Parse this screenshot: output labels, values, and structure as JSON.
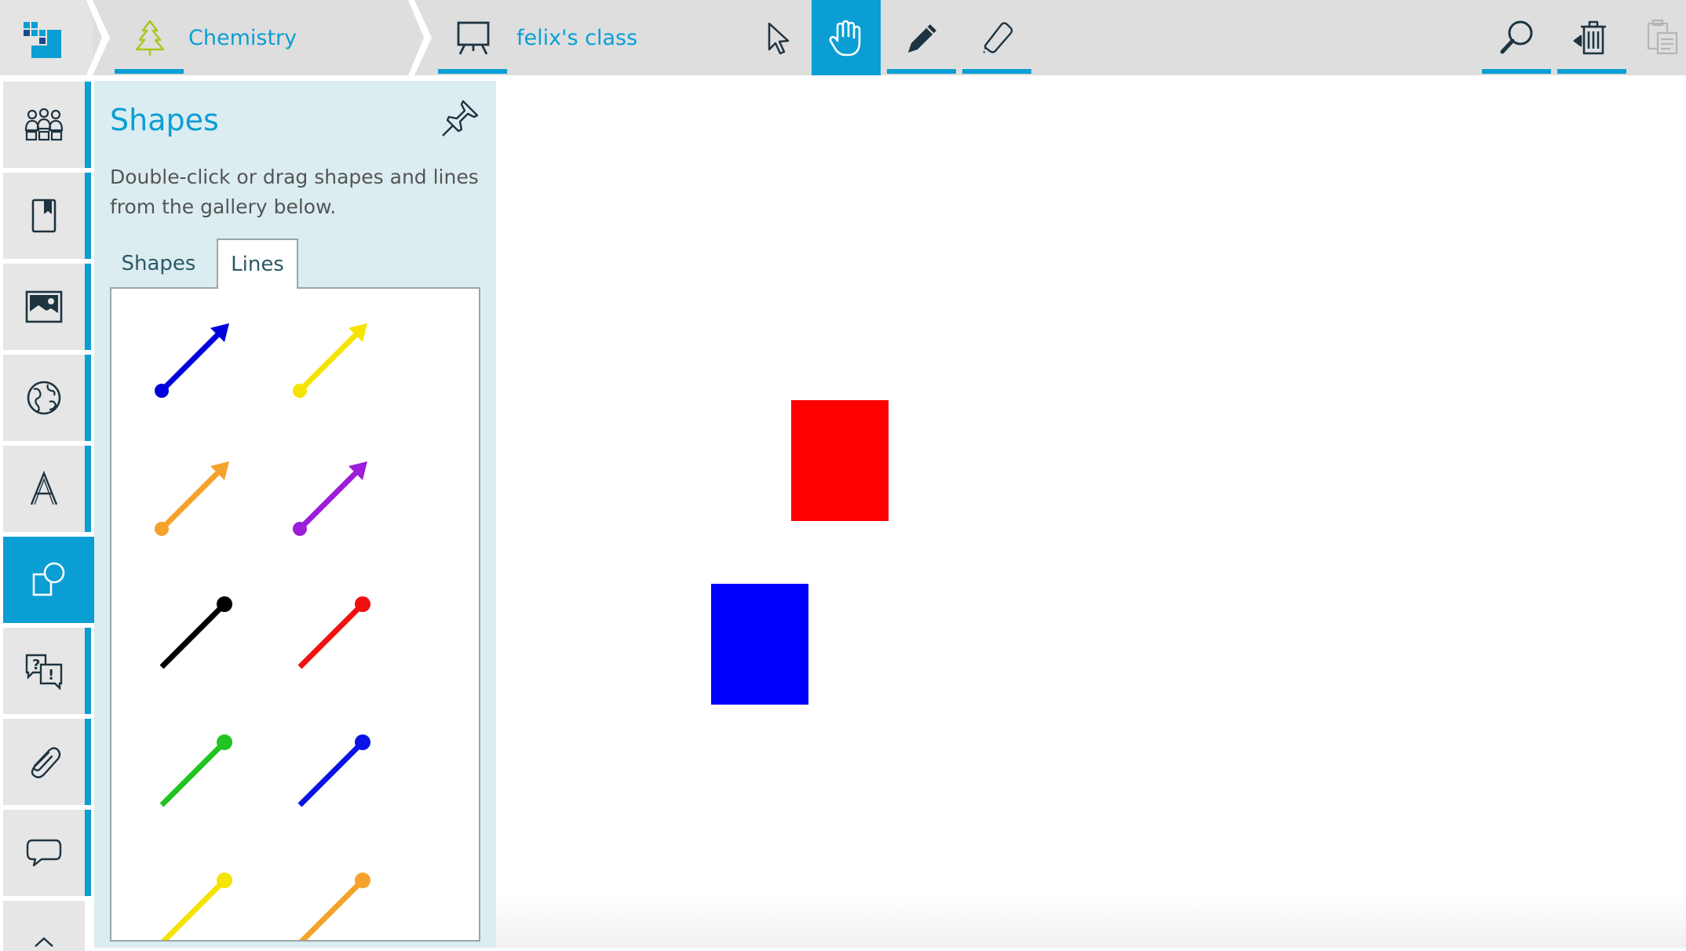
{
  "app": {
    "icons": {
      "logo": "pixel-logo-icon",
      "subject": "tree-icon",
      "class": "easel-icon"
    }
  },
  "breadcrumb": {
    "subject_label": "Chemistry",
    "class_label": "felix's class"
  },
  "toolbar": {
    "tools": [
      {
        "name": "select-tool",
        "icon": "cursor-icon",
        "active": false
      },
      {
        "name": "pan-tool",
        "icon": "hand-icon",
        "active": true
      },
      {
        "name": "pen-tool",
        "icon": "pen-icon",
        "active": false
      },
      {
        "name": "eraser-tool",
        "icon": "eraser-icon",
        "active": false
      }
    ],
    "right_tools": [
      {
        "name": "zoom-tool",
        "icon": "magnifier-icon"
      },
      {
        "name": "trash-tool",
        "icon": "trash-restore-icon"
      },
      {
        "name": "paste-tool",
        "icon": "clipboard-icon",
        "disabled": true
      }
    ]
  },
  "sidebar": {
    "items": [
      {
        "name": "groups",
        "icon": "people-icon",
        "active": false
      },
      {
        "name": "bookmarks",
        "icon": "bookmark-book-icon",
        "active": false
      },
      {
        "name": "images",
        "icon": "image-icon",
        "active": false
      },
      {
        "name": "globe",
        "icon": "globe-icon",
        "active": false
      },
      {
        "name": "text",
        "icon": "letter-a-icon",
        "active": false
      },
      {
        "name": "shapes",
        "icon": "shapes-icon",
        "active": true
      },
      {
        "name": "questions",
        "icon": "question-exclaim-icon",
        "active": false
      },
      {
        "name": "attachments",
        "icon": "paperclip-icon",
        "active": false
      },
      {
        "name": "comments",
        "icon": "speech-bubble-icon",
        "active": false
      },
      {
        "name": "more",
        "icon": "chevron-up-icon",
        "active": false
      }
    ]
  },
  "panel": {
    "title": "Shapes",
    "description": "Double-click or drag shapes and lines from the gallery below.",
    "tabs": [
      {
        "label": "Shapes",
        "selected": false
      },
      {
        "label": "Lines",
        "selected": true
      }
    ],
    "lines": [
      {
        "color": "#0000dd",
        "style": "arrow"
      },
      {
        "color": "#f5e400",
        "style": "arrow"
      },
      {
        "color": "#f5a22a",
        "style": "arrow"
      },
      {
        "color": "#9c1ed8",
        "style": "arrow"
      },
      {
        "color": "#000000",
        "style": "dot-end"
      },
      {
        "color": "#f01010",
        "style": "dot-end"
      },
      {
        "color": "#22c422",
        "style": "dot-end"
      },
      {
        "color": "#0a14e6",
        "style": "dot-end"
      },
      {
        "color": "#f5e400",
        "style": "dot-end"
      },
      {
        "color": "#f5a22a",
        "style": "dot-end"
      }
    ]
  },
  "canvas": {
    "shapes": [
      {
        "type": "rectangle",
        "color": "#ff0000"
      },
      {
        "type": "rectangle",
        "color": "#0000ff"
      }
    ]
  },
  "colors": {
    "accent": "#0a9ed4",
    "topbar_bg": "#dedede",
    "panel_bg": "#dcedf1"
  }
}
